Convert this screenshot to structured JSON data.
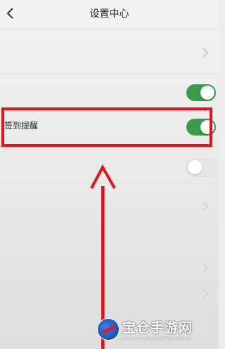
{
  "header": {
    "back_icon": "chevron-left-icon",
    "title": "设置中心"
  },
  "settings": {
    "rows": [
      {
        "id": "row1",
        "type": "nav",
        "label": ""
      },
      {
        "id": "row2",
        "type": "toggle",
        "label": "",
        "on": true
      },
      {
        "id": "row3",
        "type": "toggle",
        "label": "签到提醒",
        "on": true
      },
      {
        "id": "row4",
        "type": "toggle",
        "label": "",
        "on": false
      },
      {
        "id": "row5",
        "type": "nav",
        "label": ""
      },
      {
        "id": "row6",
        "type": "nav",
        "label": ""
      },
      {
        "id": "row7",
        "type": "nav",
        "label": ""
      }
    ]
  },
  "annotation": {
    "highlight_color": "#e8101a",
    "arrow_color": "#e8101a"
  },
  "colors": {
    "toggle_on": "#3a9a4a",
    "background": "#ededed"
  },
  "watermark": {
    "title": "宝仓手游网",
    "subtitle": "BAOCANGSHOUYOUWANG"
  }
}
